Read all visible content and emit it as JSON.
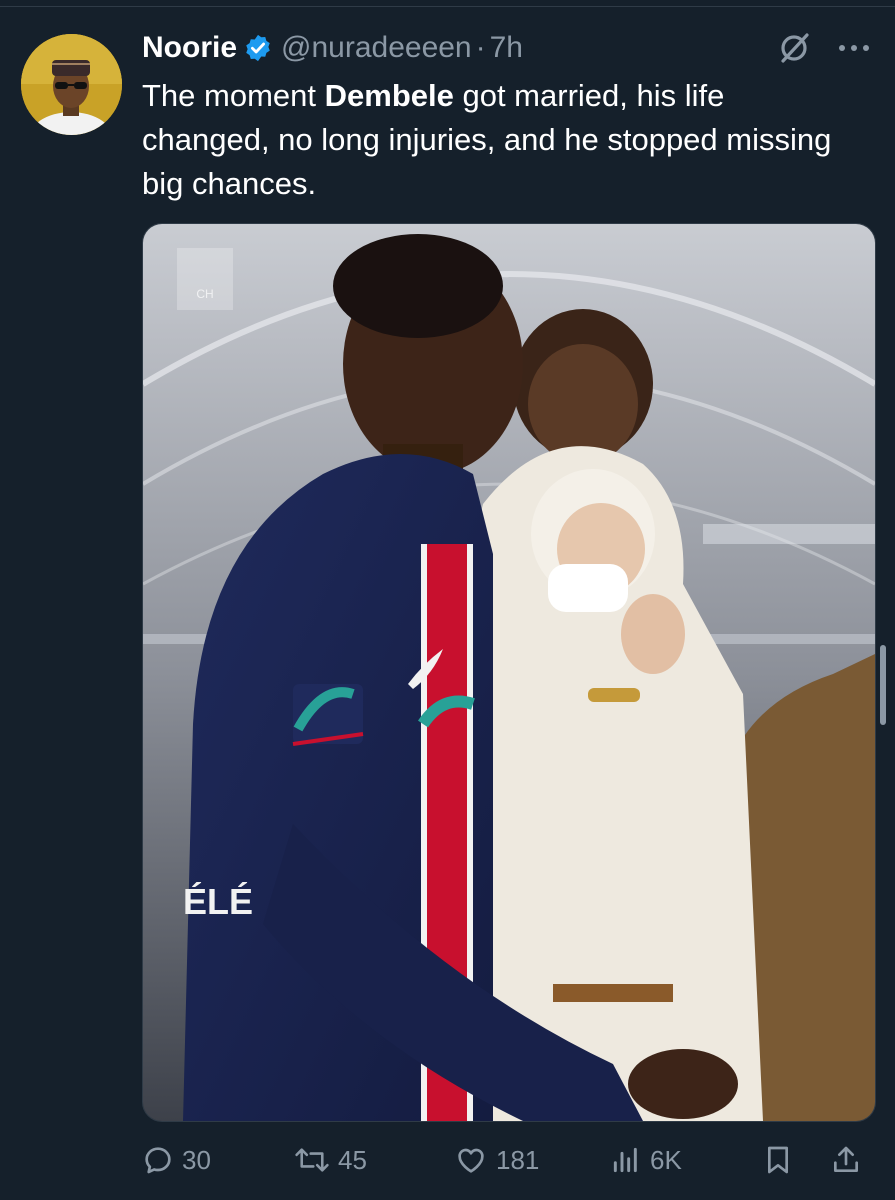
{
  "tweet": {
    "display_name": "Noorie",
    "handle": "@nuradeeeen",
    "separator": "·",
    "time": "7h",
    "text_before": "The moment ",
    "text_bold": "Dembele",
    "text_after": " got married, his life changed, no long injuries, and he stopped missing big chances.",
    "media_watermark": "CH"
  },
  "actions": {
    "replies": "30",
    "reposts": "45",
    "likes": "181",
    "views": "6K"
  },
  "icons": {
    "verified": "verified-badge-icon",
    "grok": "grok-icon",
    "more": "more-icon",
    "reply": "reply-icon",
    "repost": "repost-icon",
    "like": "like-icon",
    "views": "views-icon",
    "bookmark": "bookmark-icon",
    "share": "share-icon"
  },
  "colors": {
    "background": "#15202b",
    "text": "#ffffff",
    "muted": "#8b98a5",
    "verified": "#1d9bf0"
  }
}
